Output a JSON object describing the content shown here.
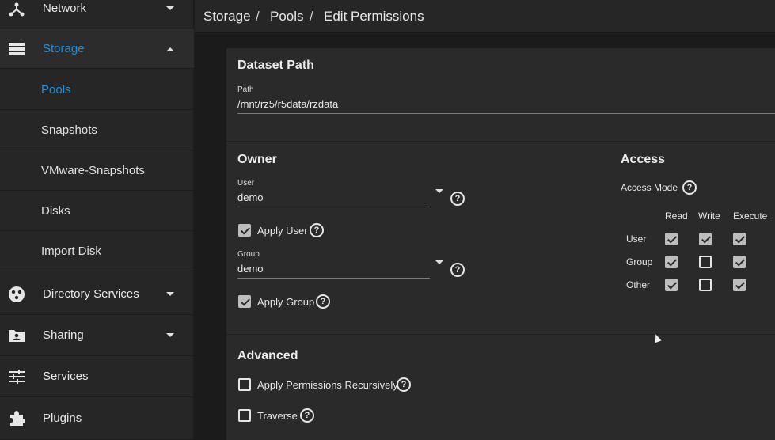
{
  "sidebar": {
    "items": [
      {
        "label": "Network",
        "icon": "network-icon"
      },
      {
        "label": "Storage",
        "icon": "storage-icon",
        "active": true
      },
      {
        "label": "Directory Services",
        "icon": "directory-services-icon"
      },
      {
        "label": "Sharing",
        "icon": "sharing-icon"
      },
      {
        "label": "Services",
        "icon": "services-icon"
      },
      {
        "label": "Plugins",
        "icon": "plugins-icon"
      }
    ],
    "storage_children": [
      "Pools",
      "Snapshots",
      "VMware-Snapshots",
      "Disks",
      "Import Disk"
    ]
  },
  "breadcrumb": {
    "items": [
      "Storage",
      "Pools",
      "Edit Permissions"
    ],
    "separator": "/"
  },
  "dataset": {
    "title": "Dataset Path",
    "path_label": "Path",
    "path_value": "/mnt/rz5/r5data/rzdata"
  },
  "owner": {
    "title": "Owner",
    "user_label": "User",
    "user_value": "demo",
    "apply_user_label": "Apply User",
    "apply_user_checked": true,
    "group_label": "Group",
    "group_value": "demo",
    "apply_group_label": "Apply Group",
    "apply_group_checked": true
  },
  "access": {
    "title": "Access",
    "mode_label": "Access Mode",
    "columns": [
      "Read",
      "Write",
      "Execute"
    ],
    "rows": [
      {
        "label": "User",
        "values": [
          true,
          true,
          true
        ]
      },
      {
        "label": "Group",
        "values": [
          true,
          false,
          true
        ]
      },
      {
        "label": "Other",
        "values": [
          true,
          false,
          true
        ]
      }
    ]
  },
  "advanced": {
    "title": "Advanced",
    "recursive_label": "Apply Permissions Recursively",
    "recursive_checked": false,
    "traverse_label": "Traverse",
    "traverse_checked": false
  },
  "colors": {
    "accent": "#1e8fe0",
    "sidebar_bg": "#262626",
    "card_bg": "#2a2a2a"
  }
}
